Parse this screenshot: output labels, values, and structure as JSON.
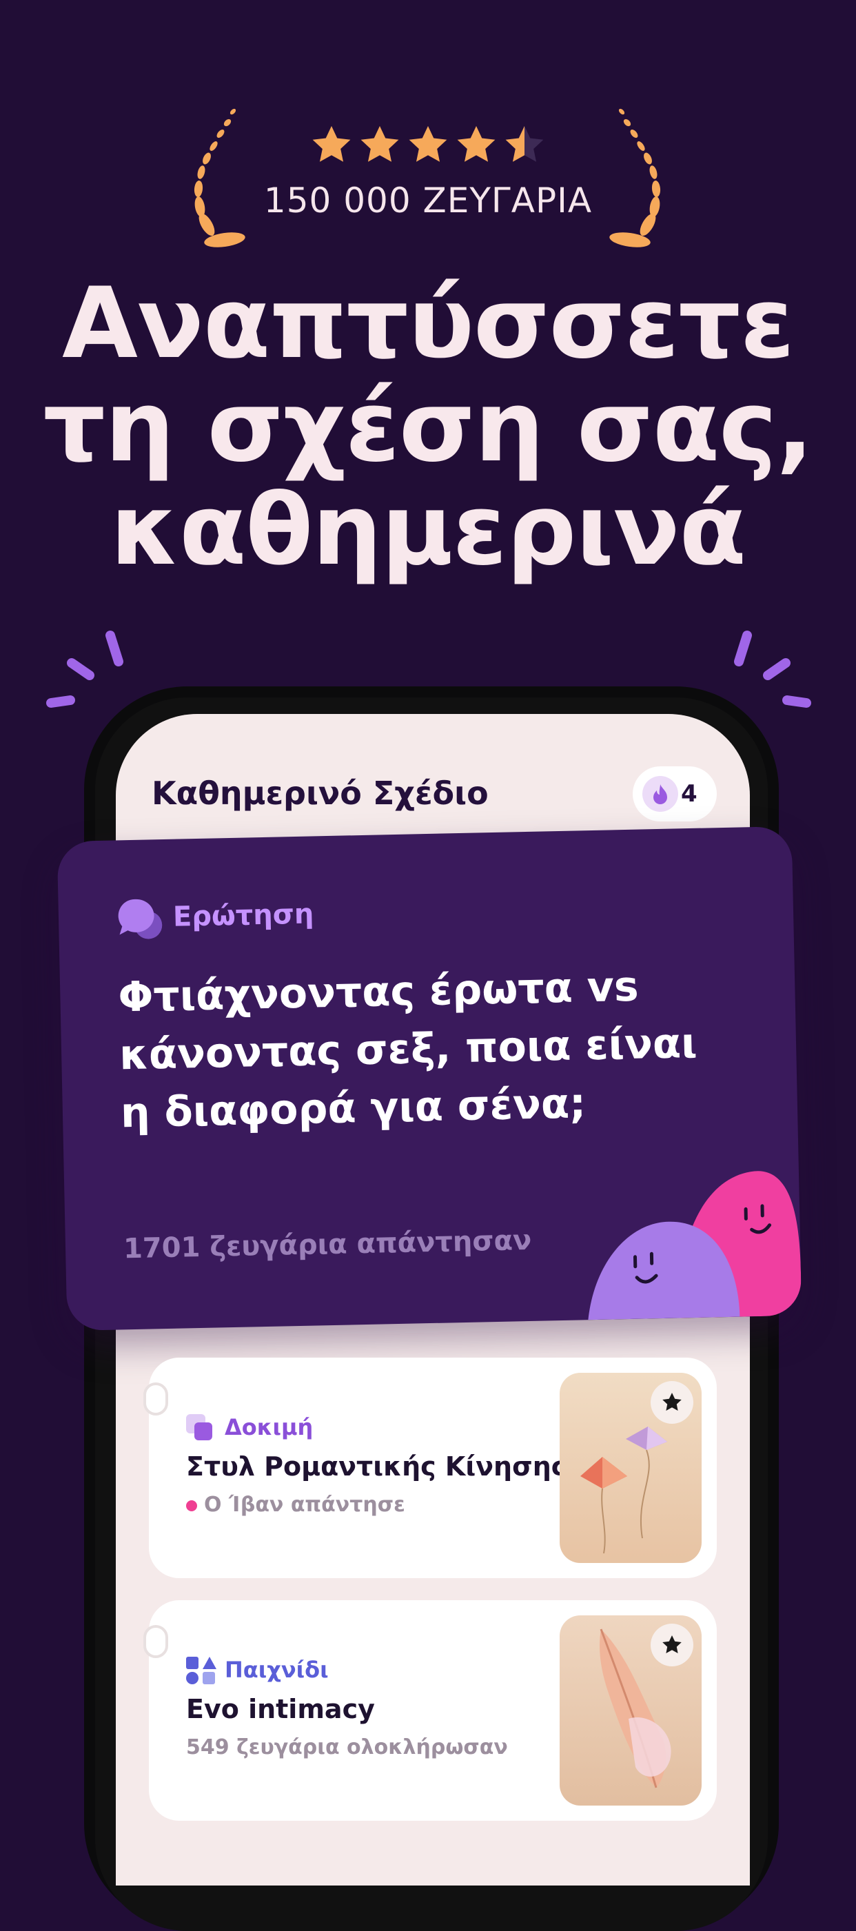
{
  "rating": {
    "stars": 4.5,
    "label": "150 000 ΖΕΥΓΑΡΙΑ",
    "star_color": "#f6a95a"
  },
  "headline": {
    "line1": "Αναπτύσσετε",
    "line2": "τη σχέση σας,",
    "line3": "καθημερινά"
  },
  "app": {
    "plan_title": "Καθημερινό Σχέδιο",
    "streak_icon": "flame-icon",
    "streak_count": "4"
  },
  "question_card": {
    "icon": "chat-bubbles-icon",
    "label": "Ερώτηση",
    "text": "Φτιάχνοντας έρωτα vs κάνοντας σεξ, ποια είναι η διαφορά για σένα;",
    "answered": "1701 ζευγάρια απάντησαν",
    "background": "#3a1a5c",
    "accent": "#c592ff"
  },
  "cards": [
    {
      "tag_icon": "stacked-squares-icon",
      "tag": "Δοκιμή",
      "tag_color": "#8a4fd8",
      "title": "Στυλ Ρομαντικής Κίνησης",
      "subtitle": "Ο Ίβαν απάντησε",
      "image": "paper-kites-image",
      "fav_icon": "star-icon"
    },
    {
      "tag_icon": "shapes-icon",
      "tag": "Παιχνίδι",
      "tag_color": "#5a5ed8",
      "title": "Evo intimacy",
      "subtitle": "549 ζευγάρια ολοκλήρωσαν",
      "image": "feather-image",
      "fav_icon": "star-icon"
    }
  ],
  "colors": {
    "background": "#210d36",
    "headline": "#f8e8ec",
    "sparkles": "#a066e8",
    "blob_purple": "#a77be8",
    "blob_pink": "#f03fa0"
  }
}
